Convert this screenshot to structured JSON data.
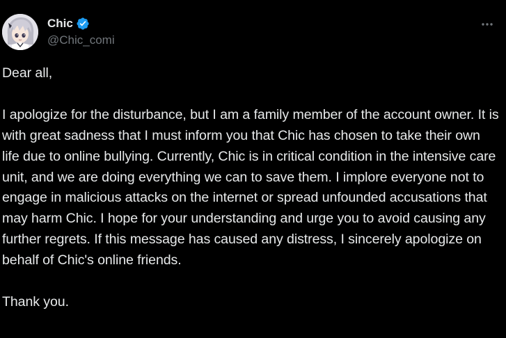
{
  "author": {
    "display_name": "Chic",
    "handle": "@Chic_comi",
    "verified": true,
    "avatar_icon": "anime-character-avatar"
  },
  "actions": {
    "more_icon": "more-horizontal-icon"
  },
  "tweet": {
    "greeting": "Dear all,",
    "body": "I apologize for the disturbance, but I am a family member of the account owner. It is with great sadness that I must inform you that Chic has chosen to take their own life due to online bullying. Currently, Chic is in critical condition in the intensive care unit, and we are doing everything we can to save them. I implore everyone not to engage in malicious attacks on the internet or spread unfounded accusations that may harm Chic. I hope for your understanding and urge you to avoid causing any further regrets. If this message has caused any distress, I sincerely apologize on behalf of Chic's online friends.",
    "closing": "Thank you."
  },
  "colors": {
    "background": "#000000",
    "primary_text": "#e7e9ea",
    "secondary_text": "#71767b",
    "verified_blue": "#1d9bf0"
  }
}
